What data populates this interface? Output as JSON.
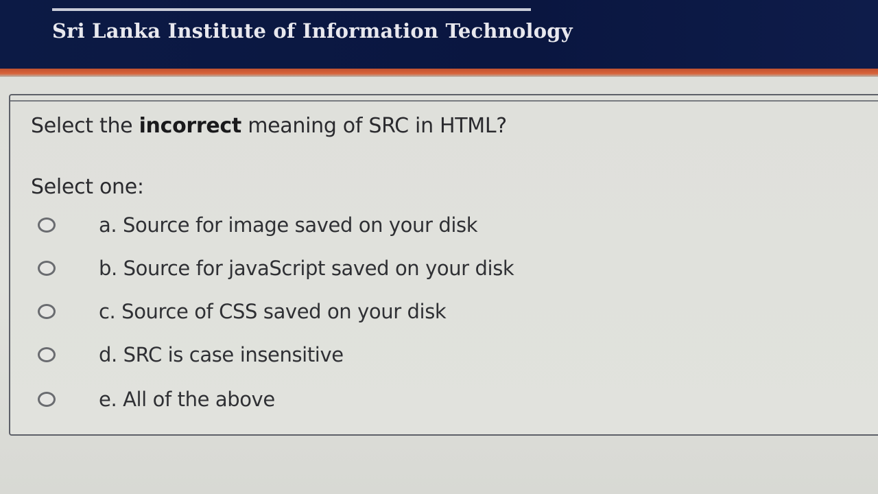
{
  "header": {
    "title": "Sri Lanka Institute of Information Technology"
  },
  "question": {
    "prefix": "Select the ",
    "emphasis": "incorrect",
    "suffix": " meaning of SRC in HTML?",
    "instruction": "Select one:",
    "options": [
      {
        "label": "a. Source for image saved on your disk",
        "selected": false
      },
      {
        "label": "b. Source for javaScript saved on your disk",
        "selected": false
      },
      {
        "label": "c. Source of CSS saved on your disk",
        "selected": false
      },
      {
        "label": "d. SRC is case insensitive",
        "selected": false
      },
      {
        "label": "e. All of the above",
        "selected": false
      }
    ]
  },
  "colors": {
    "header_bg": "#0c1a45",
    "accent": "#d8643b",
    "card_border": "#5d6068"
  }
}
